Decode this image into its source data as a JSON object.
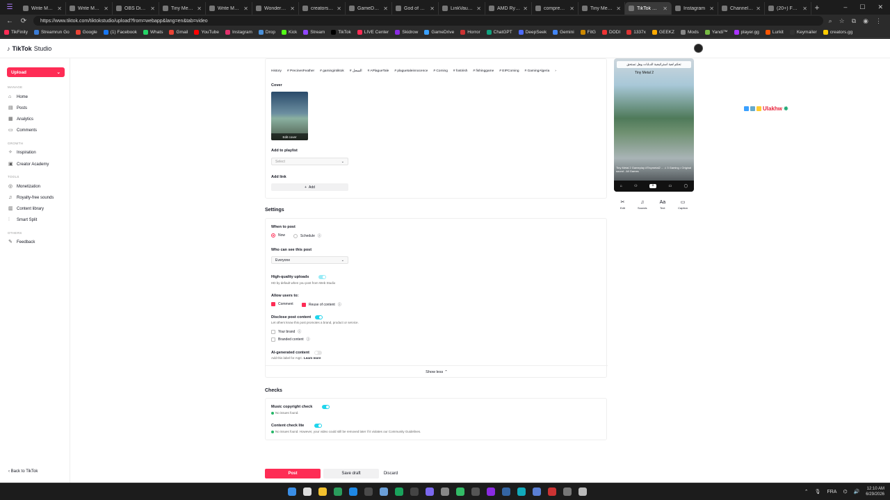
{
  "browser": {
    "tabs": [
      {
        "title": "Write Multiple",
        "active": false
      },
      {
        "title": "Write Multiple",
        "active": false
      },
      {
        "title": "OBS Disk Spa",
        "active": false
      },
      {
        "title": "Tiny Metal 2 Tr",
        "active": false
      },
      {
        "title": "Write Multiple",
        "active": false
      },
      {
        "title": "Wondershare",
        "active": false
      },
      {
        "title": "creators.gg",
        "active": false
      },
      {
        "title": "GameDrive - E",
        "active": false
      },
      {
        "title": "God of War A",
        "active": false
      },
      {
        "title": "LinkVault | Se",
        "active": false
      },
      {
        "title": "AMD Ryzen 7",
        "active": false
      },
      {
        "title": "compressbase",
        "active": false
      },
      {
        "title": "Tiny Metal 2 tr",
        "active": false
      },
      {
        "title": "TikTok Studio",
        "active": true
      },
      {
        "title": "Instagram",
        "active": false
      },
      {
        "title": "Channel conte",
        "active": false
      },
      {
        "title": "(20+) Facebo",
        "active": false
      }
    ],
    "url": "https://www.tiktok.com/tiktokstudio/upload?from=webapp&lang=en&tab=video",
    "bookmarks": [
      "TikFinity",
      "Streamrun Go",
      "Google",
      "(1) Facebook",
      "Whats",
      "Gmail",
      "YouTube",
      "Instagram",
      "Drop",
      "Kick",
      "Stream",
      "TikTok",
      "LIVE Center",
      "Skidrow",
      "GameDrive",
      "Horror",
      "ChatGPT",
      "DeepSeek",
      "Gemini",
      "FitG",
      "DODI",
      "1337x",
      "GEEKZ",
      "Mods",
      "Yandi™",
      "player.gg",
      "Lurkit",
      "Keymailer",
      "creators.gg"
    ]
  },
  "studio": {
    "logo_brand": "TikTok",
    "logo_product": "Studio",
    "upload_label": "Upload",
    "sections": {
      "manage": "MANAGE",
      "growth": "GROWTH",
      "tools": "TOOLS",
      "others": "OTHERS"
    },
    "nav": {
      "home": "Home",
      "posts": "Posts",
      "analytics": "Analytics",
      "comments": "Comments",
      "inspiration": "Inspiration",
      "creator_academy": "Creator Academy",
      "monetization": "Monetization",
      "royalty_free": "Royalty-free sounds",
      "content_library": "Content library",
      "smart_split": "Smart Split",
      "feedback": "Feedback"
    },
    "back_label": "Back to TikTok"
  },
  "form": {
    "hashtags": [
      "History",
      "# PrecinesFeather",
      "# gamingintiktok",
      "# السجل",
      "# APlagueTale",
      "# plaguetaleinnocence",
      "# Coming",
      "# fostirish",
      "# fishinggame",
      "# EIPComing",
      "# GamingAlgeria"
    ],
    "cover_label": "Cover",
    "cover_edit": "Edit cover",
    "playlist_label": "Add to playlist",
    "playlist_placeholder": "Select",
    "link_label": "Add link",
    "add_button": "Add",
    "settings_heading": "Settings",
    "when_label": "When to post",
    "when_now": "Now",
    "when_schedule": "Schedule",
    "who_label": "Who can see this post",
    "who_value": "Everyone",
    "hq_label": "High-quality uploads",
    "hq_sub": "HD by default when you post from Web Studio",
    "allow_label": "Allow users to:",
    "allow_comment": "Comment",
    "allow_reuse": "Reuse of content",
    "disclose_label": "Disclose post content",
    "disclose_sub": "Let others know this post promotes a brand, product or service.",
    "your_brand": "Your brand",
    "branded_content": "Branded content",
    "ai_label": "AI-generated content",
    "ai_sub": "Add this label for AIgC.",
    "ai_learn": "Learn more",
    "show_less": "Show less",
    "checks_heading": "Checks",
    "music_check": "Music copyright check",
    "music_status": "No issues found.",
    "content_check": "Content check lite",
    "content_status": "No issues found. However, your video could still be removed later if it violates our Community Guidelines.",
    "post_button": "Post",
    "save_draft_button": "Save draft",
    "discard_button": "Discard"
  },
  "preview": {
    "caption": "تحكم لعبة استراتيجية الدبابات وهل تستحق",
    "title": "Tiny Metal 2",
    "desc": "Tiny Metal 2 Gameplay #Tinymetal2 ... ♫ 3 Gaming • Original sound - All Games",
    "tools": [
      "Edit",
      "Sounds",
      "Text",
      "Caption"
    ]
  },
  "overlay": {
    "text": "Ulakhw"
  },
  "taskbar": {
    "lang": "FRA",
    "time": "12:10 AM",
    "date": "6/29/2026"
  },
  "colors": {
    "accent": "#fe2c55",
    "toggle_on": "#20d5ec",
    "ok": "#25b667"
  }
}
